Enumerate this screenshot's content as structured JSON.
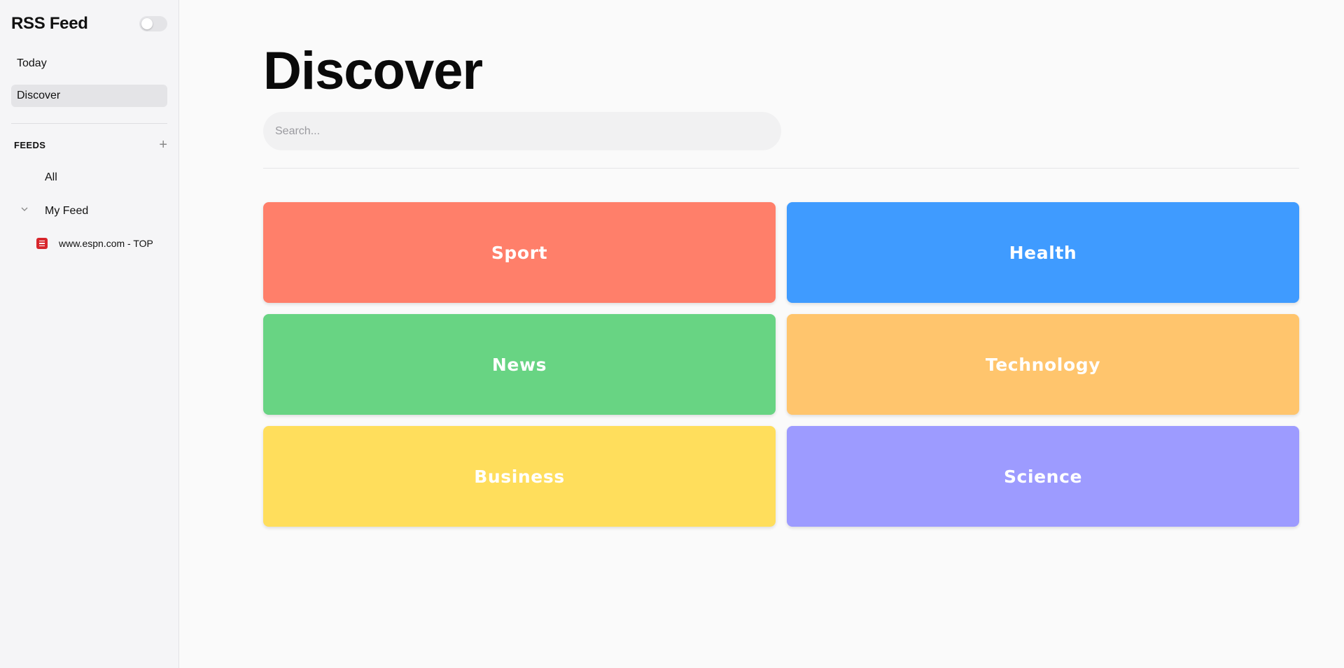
{
  "sidebar": {
    "app_title": "RSS Feed",
    "nav": [
      {
        "label": "Today",
        "active": false
      },
      {
        "label": "Discover",
        "active": true
      }
    ],
    "feeds_label": "FEEDS",
    "add_icon": "plus-icon",
    "all_label": "All",
    "group": {
      "label": "My Feed",
      "icon": "chevron-down-icon",
      "expanded": true
    },
    "feed_item": {
      "label": "www.espn.com - TOP",
      "icon": "espn-icon"
    }
  },
  "main": {
    "title": "Discover",
    "search": {
      "placeholder": "Search...",
      "value": ""
    },
    "categories": [
      {
        "label": "Sport",
        "color": "#ff7f6a"
      },
      {
        "label": "Health",
        "color": "#3f9bff"
      },
      {
        "label": "News",
        "color": "#68d483"
      },
      {
        "label": "Technology",
        "color": "#ffc56d"
      },
      {
        "label": "Business",
        "color": "#ffde5c"
      },
      {
        "label": "Science",
        "color": "#9d9bff"
      }
    ]
  }
}
